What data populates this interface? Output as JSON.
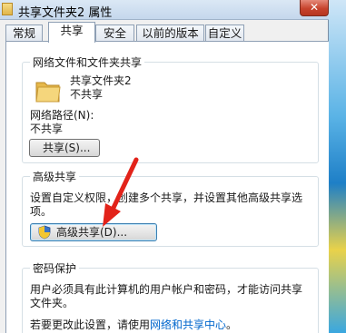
{
  "window": {
    "title": "共享文件夹2 属性",
    "close_label": "✕"
  },
  "tabs": [
    {
      "label": "常规"
    },
    {
      "label": "共享",
      "active": true
    },
    {
      "label": "安全"
    },
    {
      "label": "以前的版本"
    },
    {
      "label": "自定义"
    }
  ],
  "network_share": {
    "group_title": "网络文件和文件夹共享",
    "folder_name": "共享文件夹2",
    "status": "不共享",
    "path_label": "网络路径(N):",
    "path_value": "不共享",
    "share_button": "共享(S)..."
  },
  "advanced_share": {
    "group_title": "高级共享",
    "description_line1": "设置自定义权限，创建多个共享，并设置其他高级共享选",
    "description_line2": "项。",
    "button": "高级共享(D)..."
  },
  "password": {
    "group_title": "密码保护",
    "line1": "用户必须具有此计算机的用户帐户和密码，才能访问共享",
    "line2": "文件夹。",
    "change_prefix": "若要更改此设置，请使用",
    "link_text": "网络和共享中心",
    "change_suffix": "。"
  },
  "colors": {
    "annotation_arrow": "#e2231a",
    "link": "#0066cc",
    "close_button": "#c7432d"
  }
}
